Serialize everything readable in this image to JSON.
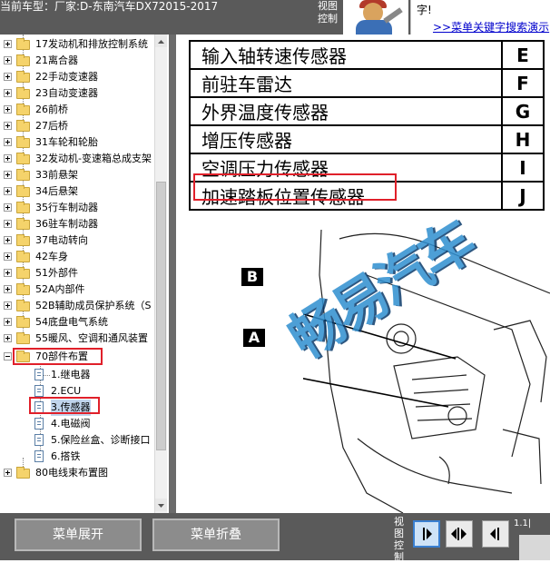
{
  "header": {
    "car_title": "当前车型：厂家:D-东南汽车DX72015-2017",
    "view_control_label": "视图控制",
    "help_text_top": "字!",
    "help_link": ">>菜单关键字搜索演示"
  },
  "tree": {
    "folders_top": [
      "17发动机和排放控制系统",
      "21离合器",
      "22手动变速器",
      "23自动变速器",
      "26前桥",
      "27后桥",
      "31车轮和轮胎",
      "32发动机-变速箱总成支架",
      "33前悬架",
      "34后悬架",
      "35行车制动器",
      "36驻车制动器",
      "37电动转向",
      "42车身",
      "51外部件",
      "52A内部件",
      "52B辅助成员保护系统（S",
      "54底盘电气系统",
      "55暖风、空调和通风装置"
    ],
    "expanded_folder": "70部件布置",
    "children": [
      "1.继电器",
      "2.ECU",
      "3.传感器",
      "4.电磁阀",
      "5.保险丝盒、诊断接口",
      "6.搭铁"
    ],
    "selected_child": "3.传感器",
    "folders_bottom": [
      "80电线束布置图"
    ]
  },
  "document": {
    "parts": [
      {
        "name": "输入轴转速传感器",
        "code": "E"
      },
      {
        "name": "前驻车雷达",
        "code": "F"
      },
      {
        "name": "外界温度传感器",
        "code": "G"
      },
      {
        "name": "增压传感器",
        "code": "H"
      },
      {
        "name": "空调压力传感器",
        "code": "I"
      },
      {
        "name": "加速踏板位置传感器",
        "code": "J"
      }
    ],
    "highlighted_part": "加速踏板位置传感器",
    "callouts": [
      "B",
      "A"
    ],
    "watermark": "畅易汽车"
  },
  "bottombar": {
    "expand_button": "菜单展开",
    "collapse_button": "菜单折叠",
    "view_control_label": "视图控制",
    "page_number": "1.1|"
  },
  "colors": {
    "chrome": "#5a5a5a",
    "highlight_red": "#e0202a",
    "watermark_blue": "#2f8fd0"
  }
}
